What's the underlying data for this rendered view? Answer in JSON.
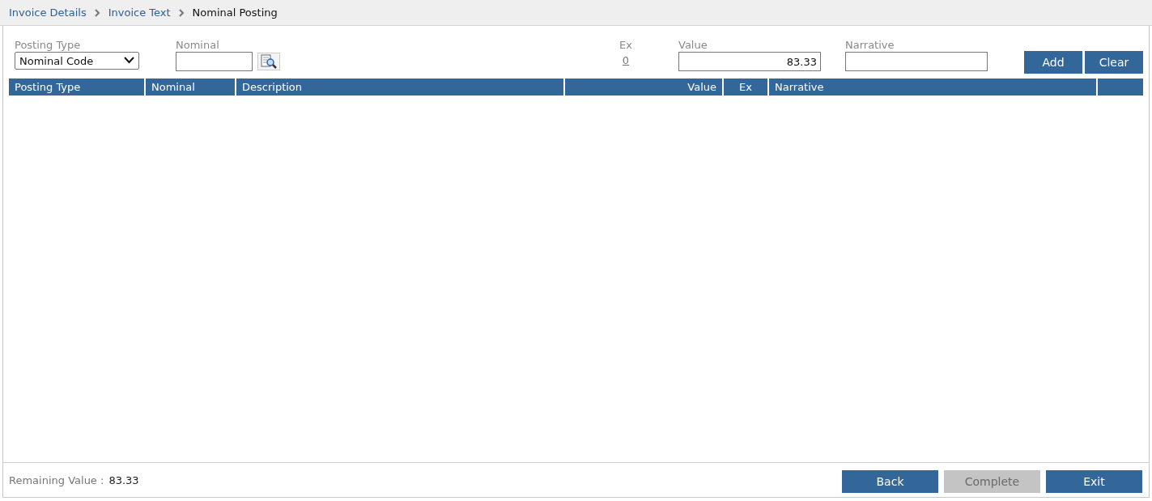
{
  "breadcrumb": [
    {
      "label": "Invoice Details",
      "kind": "link"
    },
    {
      "label": "Invoice Text",
      "kind": "link"
    },
    {
      "label": "Nominal Posting",
      "kind": "current"
    }
  ],
  "form": {
    "posting_type": {
      "label": "Posting Type",
      "value": "Nominal Code"
    },
    "nominal": {
      "label": "Nominal"
    },
    "ex": {
      "label": "Ex",
      "value": "0"
    },
    "value": {
      "label": "Value",
      "value": "83.33"
    },
    "narrative": {
      "label": "Narrative"
    },
    "buttons": [
      {
        "label": "Add",
        "disabled": false
      },
      {
        "label": "Clear",
        "disabled": false
      }
    ]
  },
  "table": {
    "columns": [
      {
        "label": "Posting Type"
      },
      {
        "label": "Nominal"
      },
      {
        "label": "Description"
      },
      {
        "label": "Value"
      },
      {
        "label": "Ex"
      },
      {
        "label": "Narrative"
      }
    ]
  },
  "footer": {
    "remaining_label": "Remaining Value :",
    "remaining_value": "83.33",
    "buttons": [
      {
        "label": "Back",
        "disabled": false
      },
      {
        "label": "Complete",
        "disabled": true
      },
      {
        "label": "Exit",
        "disabled": false
      }
    ]
  }
}
